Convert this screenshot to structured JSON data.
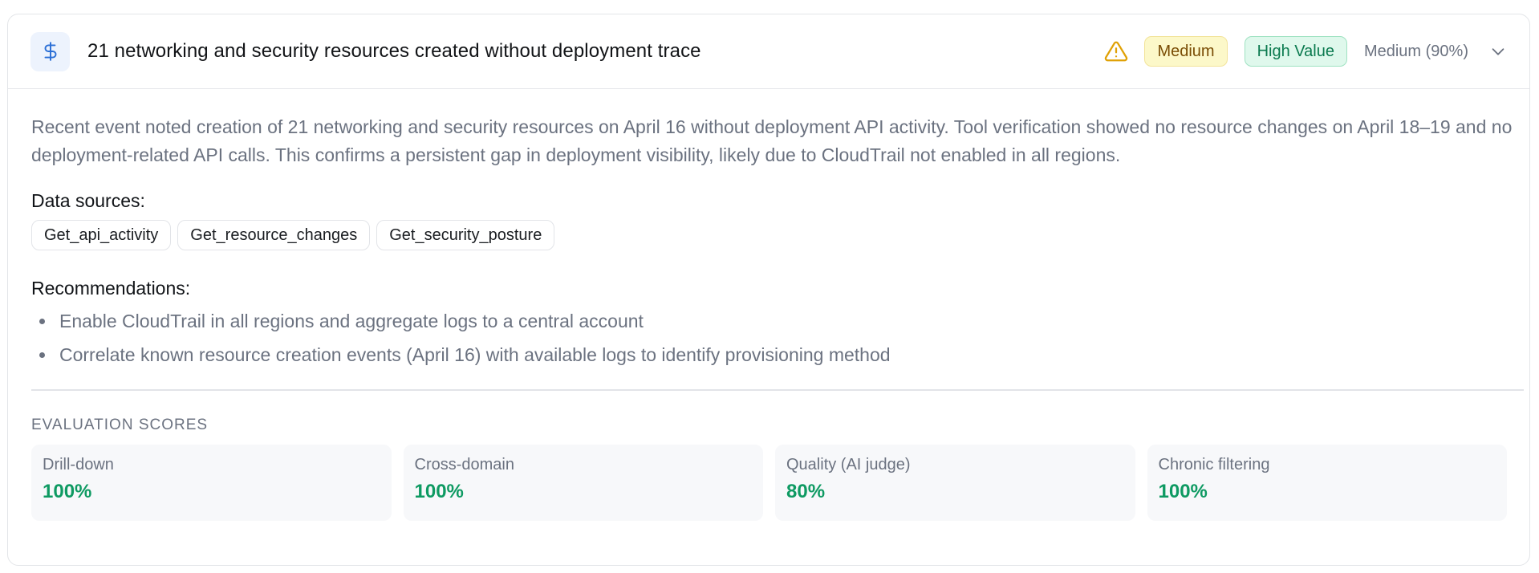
{
  "header": {
    "icon": "dollar-sign-icon",
    "title": "21 networking and security resources created without deployment trace",
    "warning_icon": "warning-triangle-icon",
    "severity_badge": "Medium",
    "value_badge": "High Value",
    "confidence": "Medium (90%)",
    "expand_icon": "chevron-down-icon"
  },
  "body": {
    "description": "Recent event noted creation of 21 networking and security resources on April 16 without deployment API activity. Tool verification showed no resource changes on April 18–19 and no deployment-related API calls. This confirms a persistent gap in deployment visibility, likely due to CloudTrail not enabled in all regions.",
    "data_sources_label": "Data sources:",
    "data_sources": [
      "Get_api_activity",
      "Get_resource_changes",
      "Get_security_posture"
    ],
    "recommendations_label": "Recommendations:",
    "recommendations": [
      "Enable CloudTrail in all regions and aggregate logs to a central account",
      "Correlate known resource creation events (April 16) with available logs to identify provisioning method"
    ]
  },
  "evaluation": {
    "heading": "EVALUATION SCORES",
    "scores": [
      {
        "label": "Drill-down",
        "value": "100%"
      },
      {
        "label": "Cross-domain",
        "value": "100%"
      },
      {
        "label": "Quality (AI judge)",
        "value": "80%"
      },
      {
        "label": "Chronic filtering",
        "value": "100%"
      }
    ]
  },
  "colors": {
    "accent_blue": "#2b6fd6",
    "warning": "#e0a106",
    "score_green": "#0e9a62",
    "medium_badge_bg": "#fcf8c9",
    "value_badge_bg": "#dff8ec"
  }
}
